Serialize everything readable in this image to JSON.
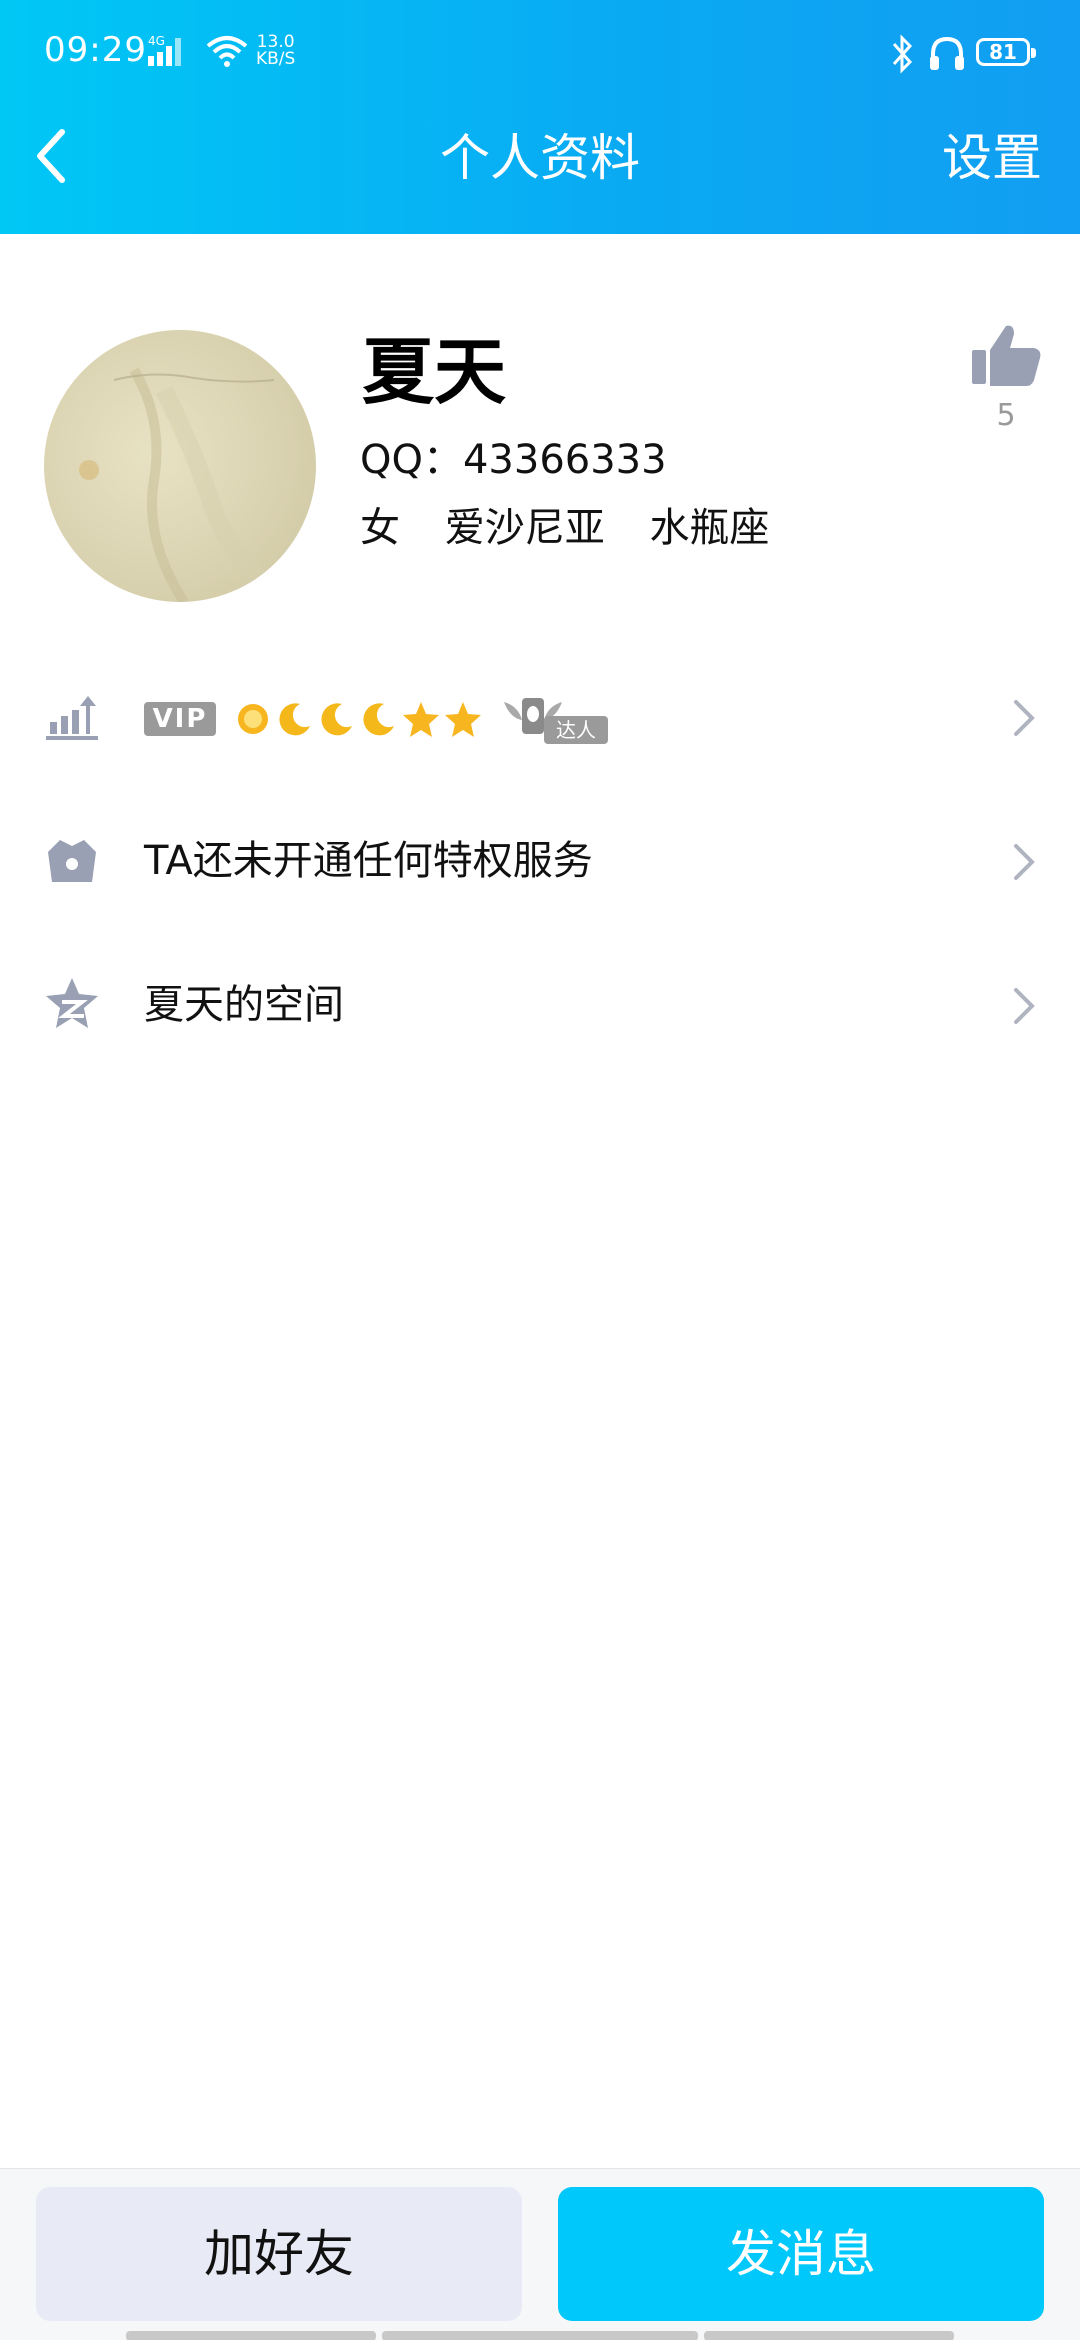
{
  "status_bar": {
    "time": "09:29",
    "network": "4G",
    "speed_value": "13.0",
    "speed_unit": "KB/S",
    "battery": "81"
  },
  "header": {
    "title": "个人资料",
    "settings_label": "设置"
  },
  "profile": {
    "nickname": "夏天",
    "qq_label": "QQ：43366333",
    "gender": "女",
    "country": "爱沙尼亚",
    "zodiac": "水瓶座",
    "like_count": "5"
  },
  "rows": {
    "level": {
      "vip_label": "VIP",
      "daren_label": "达人",
      "level_icons": [
        "sun",
        "moon",
        "moon",
        "moon",
        "star",
        "star"
      ]
    },
    "privilege": {
      "label": "TA还未开通任何特权服务"
    },
    "qzone": {
      "label": "夏天的空间"
    }
  },
  "bottom": {
    "add_friend_label": "加好友",
    "send_message_label": "发消息"
  },
  "colors": {
    "header_gradient_start": "#00c8f5",
    "header_gradient_end": "#129ef2",
    "primary_button": "#00c8fb",
    "secondary_button": "#e8ebf5",
    "icon_gray": "#9aa0b4"
  }
}
